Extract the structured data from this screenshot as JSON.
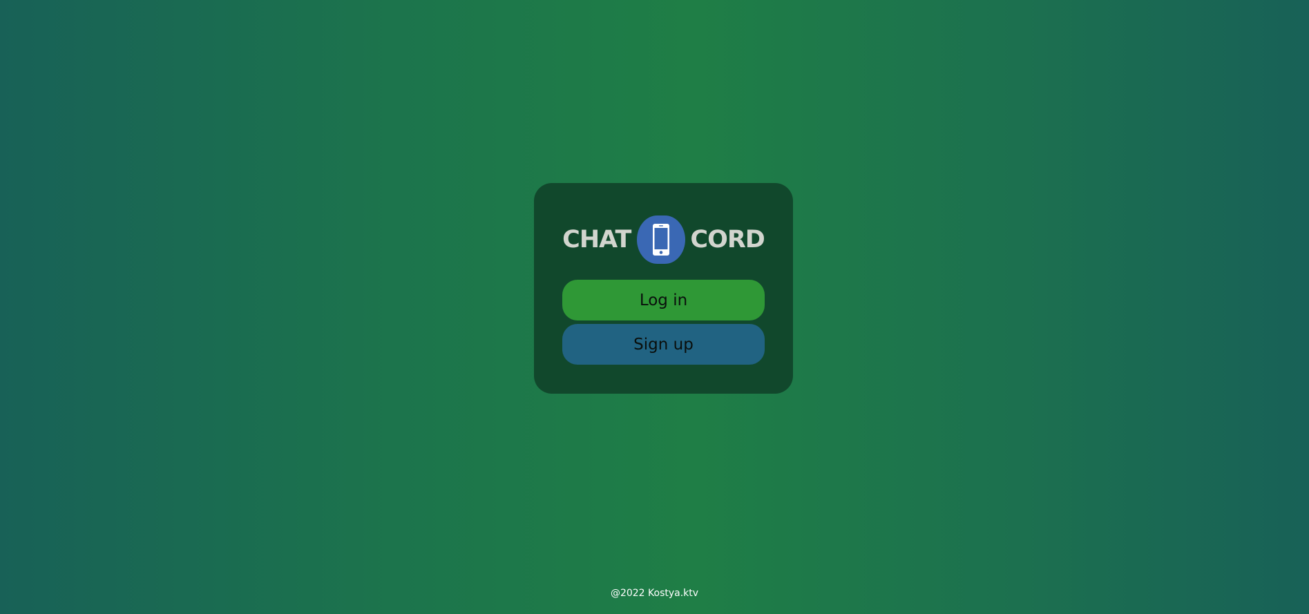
{
  "brand": {
    "word_left": "CHAT",
    "word_right": "CORD",
    "logo_icon": "smartphone-icon",
    "logo_badge_color": "#3a68b4"
  },
  "actions": {
    "login_label": "Log in",
    "login_color": "#2f9836",
    "signup_label": "Sign up",
    "signup_color": "#216382"
  },
  "footer": {
    "text": "@2022 Kostya.ktv"
  }
}
